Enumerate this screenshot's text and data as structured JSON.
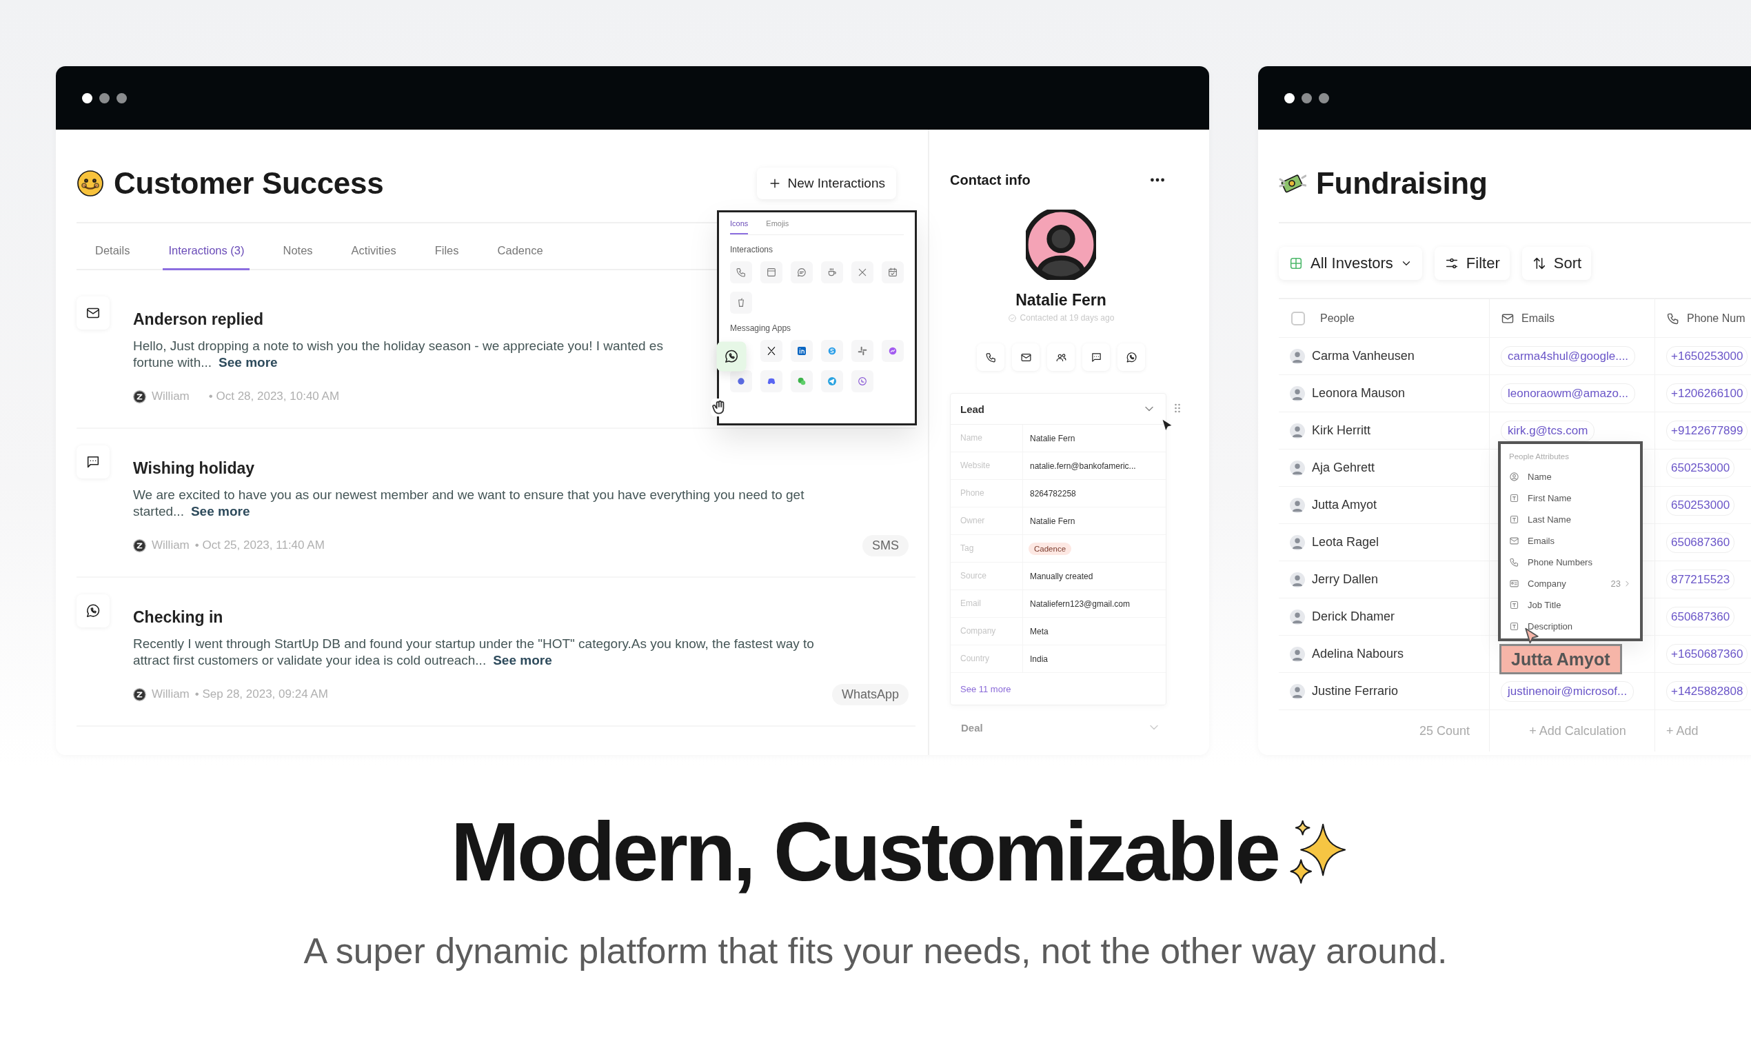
{
  "left_window": {
    "title": "Customer Success",
    "new_button": "New Interactions",
    "tabs": [
      {
        "label": "Details",
        "selected": false
      },
      {
        "label": "Interactions (3)",
        "selected": true
      },
      {
        "label": "Notes",
        "selected": false
      },
      {
        "label": "Activities",
        "selected": false
      },
      {
        "label": "Files",
        "selected": false
      },
      {
        "label": "Cadence",
        "selected": false
      }
    ],
    "interactions": [
      {
        "kind": "email",
        "title": "Anderson replied",
        "lines": [
          "Hello, Just dropping a note to wish you the holiday season - we appreciate you!  I wanted es",
          "fortune with..."
        ],
        "see_more": "See more",
        "author": "William",
        "date": "• Oct 28, 2023, 10:40 AM"
      },
      {
        "kind": "sms",
        "title": "Wishing holiday",
        "lines": [
          "We are excited to have you as our newest member and we want to ensure that you have everything you need to get",
          "started..."
        ],
        "see_more": "See more",
        "author": "William",
        "date": "• Oct 25, 2023, 11:40 AM",
        "channel": "SMS"
      },
      {
        "kind": "whatsapp",
        "title": "Checking in",
        "lines": [
          "Recently I went through StartUp DB and found your startup under the \"HOT\" category.As you know, the fastest way to",
          "attract first customers or validate your idea is cold outreach..."
        ],
        "see_more": "See more",
        "author": "William",
        "date": "• Sep 28, 2023, 09:24 AM",
        "channel": "WhatsApp"
      }
    ],
    "icon_picker": {
      "tabs": [
        {
          "label": "Icons",
          "selected": true
        },
        {
          "label": "Emojis",
          "selected": false
        }
      ],
      "sections": [
        "Interactions",
        "Messaging Apps"
      ]
    },
    "contact": {
      "heading": "Contact info",
      "name": "Natalie Fern",
      "status": "Contacted at 19 days ago",
      "lead": {
        "title": "Lead",
        "rows": [
          {
            "label": "Name",
            "value": "Natalie Fern",
            "kind": "text"
          },
          {
            "label": "Website",
            "value": "natalie.fern@bankofameric...",
            "kind": "text"
          },
          {
            "label": "Phone",
            "value": "8264782258",
            "kind": "text"
          },
          {
            "label": "Owner",
            "value": "Natalie Fern",
            "kind": "text"
          },
          {
            "label": "Tag",
            "value": "Cadence",
            "kind": "tag"
          },
          {
            "label": "Source",
            "value": "Manually created",
            "kind": "text"
          },
          {
            "label": "Email",
            "value": "Nataliefern123@gmail.com",
            "kind": "text"
          },
          {
            "label": "Company",
            "value": "Meta",
            "kind": "text"
          },
          {
            "label": "Country",
            "value": "India",
            "kind": "text"
          }
        ],
        "more": "See 11 more"
      },
      "deal": "Deal"
    }
  },
  "right_window": {
    "title": "Fundraising",
    "toolbar": {
      "view": "All Investors",
      "filter": "Filter",
      "sort": "Sort"
    },
    "table": {
      "select_all": {
        "checked": false
      },
      "columns": [
        "People",
        "Emails",
        "Phone Num"
      ],
      "rows": [
        {
          "name": "Carma Vanheusen",
          "email": "carma4shul@google....",
          "phone": "+1650253000"
        },
        {
          "name": "Leonora Mauson",
          "email": "leonoraowm@amazo...",
          "phone": "+1206266100"
        },
        {
          "name": "Kirk Herritt",
          "email": "kirk.g@tcs.com",
          "phone": "+9122677899"
        },
        {
          "name": "Aja Gehrett",
          "phone": "650253000"
        },
        {
          "name": "Jutta Amyot",
          "phone": "650253000"
        },
        {
          "name": "Leota Ragel",
          "phone": "650687360"
        },
        {
          "name": "Jerry Dallen",
          "phone": "877215523"
        },
        {
          "name": "Derick Dhamer",
          "phone": "650687360"
        },
        {
          "name": "Adelina Nabours",
          "phone": "+1650687360"
        },
        {
          "name": "Justine Ferrario",
          "email": "justinenoir@microsof...",
          "phone": "+1425882808"
        }
      ],
      "footer": [
        "25  Count",
        "+ Add Calculation",
        "+ Add"
      ]
    },
    "attributes_menu": {
      "heading": "People Attributes",
      "items": [
        {
          "label": "Name",
          "kind": "person"
        },
        {
          "label": "First Name",
          "kind": "text"
        },
        {
          "label": "Last Name",
          "kind": "text"
        },
        {
          "label": "Emails",
          "kind": "email"
        },
        {
          "label": "Phone Numbers",
          "kind": "phone"
        },
        {
          "label": "Company",
          "kind": "company",
          "count": "23"
        },
        {
          "label": "Job Title",
          "kind": "text"
        },
        {
          "label": "Description",
          "kind": "text"
        }
      ]
    },
    "drag_label": "Jutta Amyot"
  },
  "headline": "Modern, Customizable",
  "subtitle": "A super dynamic platform that fits your needs, not the other way around."
}
